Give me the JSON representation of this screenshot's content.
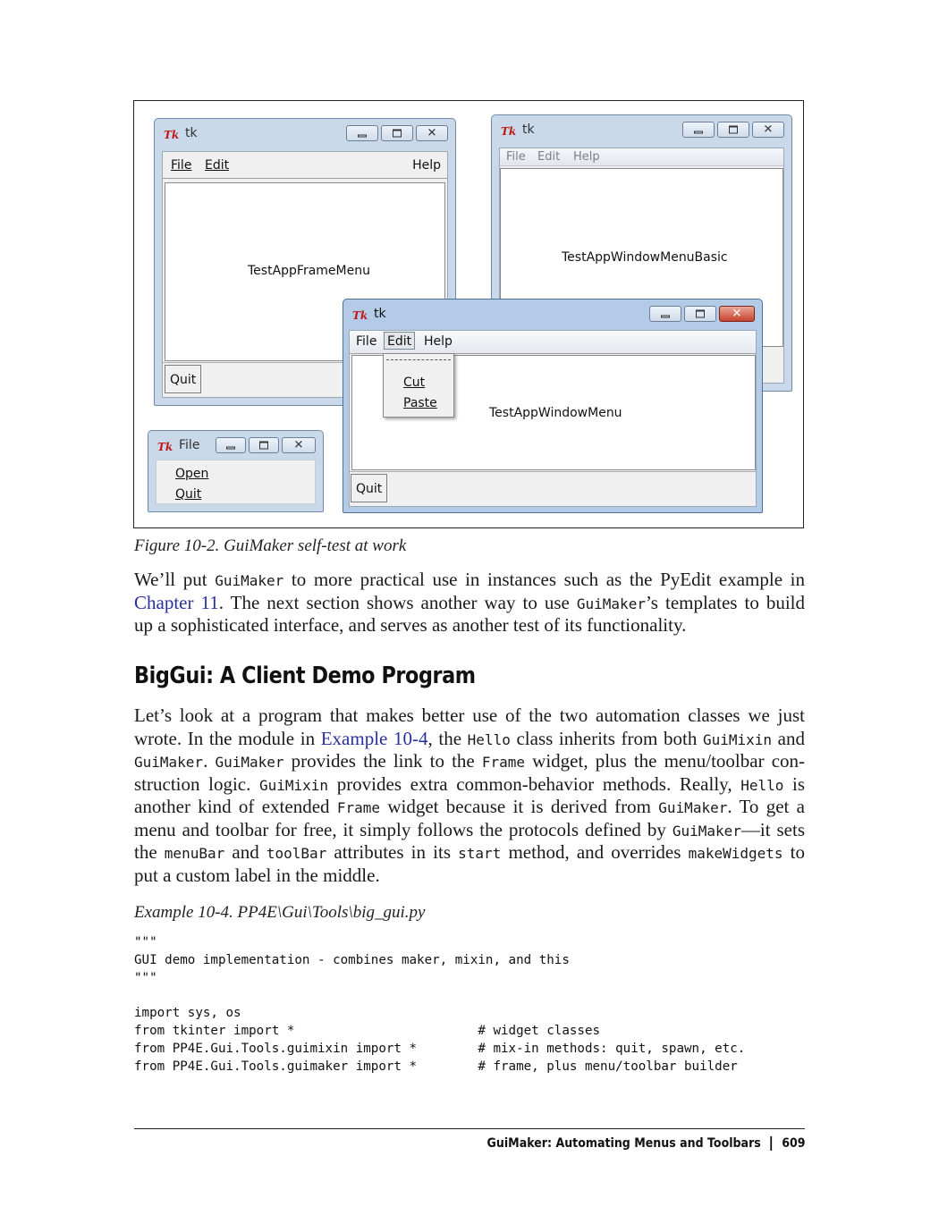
{
  "figure": {
    "win_frame_menu": {
      "title": "tk",
      "menus": [
        "File",
        "Edit",
        "Help"
      ],
      "label": "TestAppFrameMenu",
      "quit": "Quit"
    },
    "win_menu_basic": {
      "title": "tk",
      "menus": [
        "File",
        "Edit",
        "Help"
      ],
      "label": "TestAppWindowMenuBasic"
    },
    "win_menu": {
      "title": "tk",
      "menus": [
        "File",
        "Edit",
        "Help"
      ],
      "label": "TestAppWindowMenu",
      "quit": "Quit",
      "popup_items": [
        "Cut",
        "Paste"
      ]
    },
    "win_file_tearoff": {
      "title": "File",
      "items": [
        "Open",
        "Quit"
      ]
    }
  },
  "caption": "Figure 10-2. GuiMaker self-test at work",
  "para1": {
    "l1a": "We’ll put ",
    "l1code": "GuiMaker",
    "l1b": " to more practical use in instances such as the PyEdit example in",
    "l2link": "Chapter 11",
    "l2a": ". The next section shows another way to use ",
    "l2code": "GuiMaker",
    "l2b": "’s templates to build",
    "l3": "up a sophisticated interface, and serves as another test of its functionality."
  },
  "heading": "BigGui: A Client Demo Program",
  "para2": {
    "l1": "Let’s look at a program that makes better use of the two automation classes we just",
    "l2a": "wrote. In the module in ",
    "l2link": "Example 10-4",
    "l2b": ", the ",
    "l2c1": "Hello",
    "l2c": " class inherits from both ",
    "l2c2": "GuiMixin",
    "l2d": " and",
    "l3c1": "GuiMaker",
    "l3a": ". ",
    "l3c2": "GuiMaker",
    "l3b": " provides the link to the ",
    "l3c3": "Frame",
    "l3c": " widget, plus the menu/toolbar con-",
    "l4a": "struction logic. ",
    "l4c1": "GuiMixin",
    "l4b": " provides extra common-behavior methods. Really, ",
    "l4c2": "Hello",
    "l4c": " is",
    "l5a": "another kind of extended ",
    "l5c1": "Frame",
    "l5b": " widget because it is derived from ",
    "l5c2": "GuiMaker",
    "l5c": ". To get a",
    "l6a": "menu and toolbar for free, it simply follows the protocols defined by ",
    "l6c1": "GuiMaker",
    "l6b": "—it sets",
    "l7a": "the ",
    "l7c1": "menuBar",
    "l7b": " and ",
    "l7c2": "toolBar",
    "l7c": " attributes in its ",
    "l7c3": "start",
    "l7d": " method, and overrides ",
    "l7c4": "makeWidgets",
    "l7e": " to",
    "l8": "put a custom label in the middle."
  },
  "example_title": "Example 10-4. PP4E\\Gui\\Tools\\big_gui.py",
  "code_lines": [
    "\"\"\"",
    "GUI demo implementation - combines maker, mixin, and this",
    "\"\"\"",
    "",
    "import sys, os",
    "from tkinter import *                        # widget classes",
    "from PP4E.Gui.Tools.guimixin import *        # mix-in methods: quit, spawn, etc.",
    "from PP4E.Gui.Tools.guimaker import *        # frame, plus menu/toolbar builder"
  ],
  "footer": {
    "title": "GuiMaker: Automating Menus and Toolbars",
    "page": "609"
  },
  "colors": {
    "link": "#2830a0",
    "window_frame": "#c9d9ea",
    "close_red": "#c8432e"
  }
}
